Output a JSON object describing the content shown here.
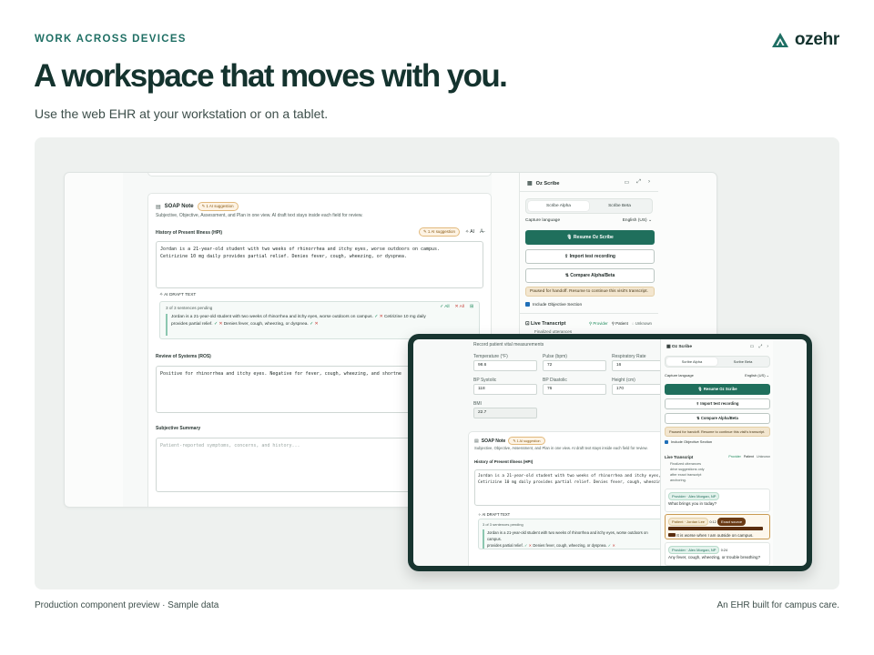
{
  "header": {
    "eyebrow": "WORK ACROSS DEVICES",
    "brand": "ozehr",
    "headline": "A workspace that moves with you.",
    "subline": "Use the web EHR at your workstation or on a tablet."
  },
  "footer": {
    "left": "Production component preview · Sample data",
    "right": "An EHR built for campus care."
  },
  "colors": {
    "brand": "#1f6f64",
    "primary_button": "#1f6f5c",
    "tablet_frame": "#183530"
  },
  "desktop": {
    "soap": {
      "title": "SOAP Note",
      "badge": "1 AI suggestion",
      "subtitle": "Subjective, Objective, Assessment, and Plan in one view. AI draft text stays inside each field for review.",
      "hpi_label": "History of Present Illness (HPI)",
      "hpi_badge": "1 AI suggestion",
      "ai_label": "AI",
      "hpi_text": "Jordan is a 21-year-old student with two weeks of rhinorrhea and itchy eyes, worse outdoors on campus.\nCetirizine 10 mg daily provides partial relief. Denies fever, cough, wheezing, or dyspnea.",
      "draft_label": "AI DRAFT TEXT",
      "pending": "3 of 3 sentences pending",
      "all_accept": "All",
      "all_reject": "All",
      "draft_s1": "Jordan is a 21-year-old student with two weeks of rhinorrhea and itchy eyes, worse outdoors on campus.",
      "draft_s2": "Cetirizine 10 mg daily",
      "draft_s3": "provides partial relief.",
      "draft_s4": "Denies fever, cough, wheezing, or dyspnea.",
      "ros_label": "Review of Systems (ROS)",
      "ros_text": "Positive for rhinorrhea and itchy eyes. Negative for fever, cough, wheezing, and shortne",
      "subj_label": "Subjective Summary",
      "subj_placeholder": "Patient-reported symptoms, concerns, and history..."
    },
    "scribe": {
      "title": "Oz Scribe",
      "tab_alpha": "Scribe Alpha",
      "tab_beta": "Scribe Beta",
      "capture_label": "Capture language",
      "capture_value": "English (US)",
      "resume": "Resume Oz Scribe",
      "import": "Import test recording",
      "compare": "Compare Alpha/Beta",
      "paused": "Paused for handoff. Resume to continue this visit's transcript.",
      "include_obj": "Include Objective Section",
      "live_title": "Live Transcript",
      "live_sub": "Finalized utterances",
      "legend_provider": "Provider",
      "legend_patient": "Patient",
      "legend_unknown": "Unknown"
    }
  },
  "tablet": {
    "vitals": {
      "intro": "Record patient vital measurements",
      "temperature_label": "Temperature (°F)",
      "temperature": "98.6",
      "pulse_label": "Pulse (bpm)",
      "pulse": "72",
      "resp_label": "Respiratory Rate",
      "resp": "16",
      "bp_sys_label": "BP Systolic",
      "bp_sys": "118",
      "bp_dia_label": "BP Diastolic",
      "bp_dia": "76",
      "height_label": "Height (cm)",
      "height": "170",
      "bmi_label": "BMI",
      "bmi": "22.7"
    },
    "soap": {
      "title": "SOAP Note",
      "badge": "1 AI suggestion",
      "subtitle": "Subjective, Objective, Assessment, and Plan in one view. AI draft text stays inside each field for review.",
      "hpi_label": "History of Present Illness (HPI)",
      "hpi_text": "Jordan is a 21-year-old student with two weeks of rhinorrhea and itchy eyes, worse outdo\nCetirizine 10 mg daily provides partial relief. Denies fever, cough, wheezin",
      "draft_label": "AI DRAFT TEXT",
      "pending": "3 of 3 sentences pending",
      "draft_s1": "Jordan is a 21-year-old student with two weeks of rhinorrhea and itchy eyes, worse outdoors on campus.",
      "draft_s2": "provides partial relief.",
      "draft_s3": "Denies fever, cough, wheezing, or dyspnea."
    },
    "scribe": {
      "title": "Oz Scribe",
      "tab_alpha": "Scribe Alpha",
      "tab_beta": "Scribe Beta",
      "capture_label": "Capture language",
      "capture_value": "English (US)",
      "resume": "Resume Oz Scribe",
      "import": "Import test recording",
      "compare": "Compare Alpha/Beta",
      "paused": "Paused for handoff. Resume to continue this visit's transcript.",
      "include_obj": "Include Objective Section",
      "live_title": "Live Transcript",
      "live_sub1": "Finalized utterances",
      "live_sub2": "drive suggestions only",
      "live_sub3": "after exact transcript",
      "live_sub4": "anchoring.",
      "legend_provider": "Provider",
      "legend_patient": "Patient",
      "legend_unknown": "Unknown",
      "msg1_speaker": "Provider · Alex Morgan, NP",
      "msg1_text": "What brings you in today?",
      "msg2_speaker": "Patient · Jordan Lee",
      "msg2_time": "0:12",
      "msg2_tag": "Exact source",
      "msg2_text": "It is worse when I am outside on campus.",
      "msg3_speaker": "Provider · Alex Morgan, NP",
      "msg3_time": "0:24",
      "msg3_text": "Any fever, cough, wheezing, or trouble breathing?"
    }
  }
}
